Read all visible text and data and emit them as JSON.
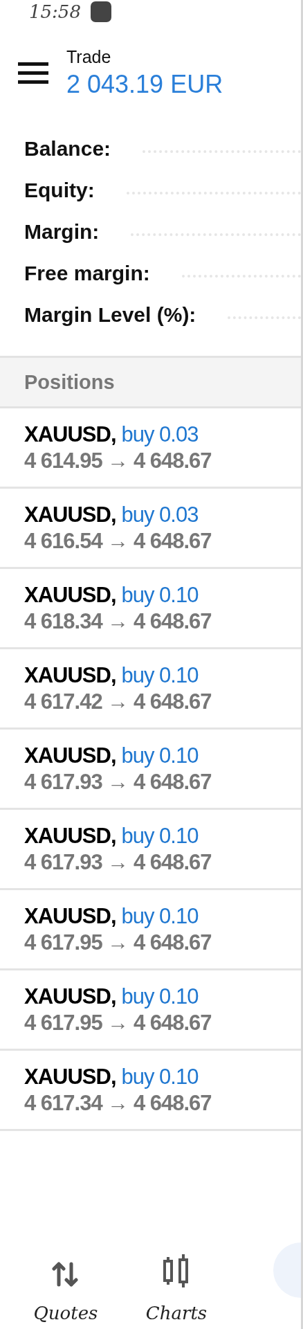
{
  "status_bar": {
    "time": "15:58"
  },
  "header": {
    "title": "Trade",
    "amount": "2 043.19 EUR"
  },
  "summary": [
    {
      "label": "Balance:"
    },
    {
      "label": "Equity:"
    },
    {
      "label": "Margin:"
    },
    {
      "label": "Free margin:"
    },
    {
      "label": "Margin Level (%):"
    }
  ],
  "positions": {
    "title": "Positions",
    "items": [
      {
        "symbol": "XAUUSD,",
        "order": "buy 0.03",
        "prices": "4 614.95 → 4 648.67"
      },
      {
        "symbol": "XAUUSD,",
        "order": "buy 0.03",
        "prices": "4 616.54 → 4 648.67"
      },
      {
        "symbol": "XAUUSD,",
        "order": "buy 0.10",
        "prices": "4 618.34 → 4 648.67"
      },
      {
        "symbol": "XAUUSD,",
        "order": "buy 0.10",
        "prices": "4 617.42 → 4 648.67"
      },
      {
        "symbol": "XAUUSD,",
        "order": "buy 0.10",
        "prices": "4 617.93 → 4 648.67"
      },
      {
        "symbol": "XAUUSD,",
        "order": "buy 0.10",
        "prices": "4 617.93 → 4 648.67"
      },
      {
        "symbol": "XAUUSD,",
        "order": "buy 0.10",
        "prices": "4 617.95 → 4 648.67"
      },
      {
        "symbol": "XAUUSD,",
        "order": "buy 0.10",
        "prices": "4 617.95 → 4 648.67"
      },
      {
        "symbol": "XAUUSD,",
        "order": "buy 0.10",
        "prices": "4 617.34 → 4 648.67"
      }
    ]
  },
  "bottom_nav": [
    {
      "kind": "quotes",
      "label": "Quotes"
    },
    {
      "kind": "charts",
      "label": "Charts"
    }
  ]
}
